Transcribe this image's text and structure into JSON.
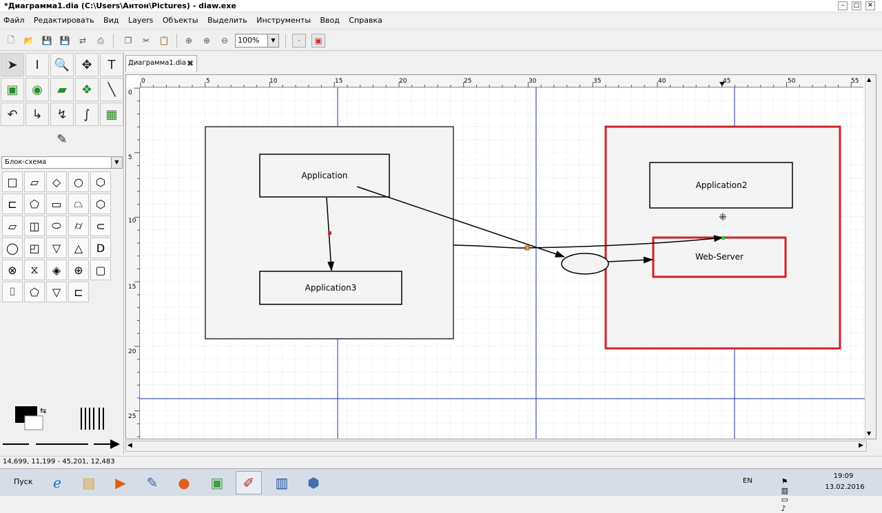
{
  "window": {
    "title": "*Диаграмма1.dia (C:\\Users\\Антон\\Pictures) - diaw.exe",
    "min": "–",
    "max": "□",
    "close": "✕"
  },
  "menu": [
    "Файл",
    "Редактировать",
    "Вид",
    "Layers",
    "Объекты",
    "Выделить",
    "Инструменты",
    "Ввод",
    "Справка"
  ],
  "toolbar": {
    "zoom_value": "100%"
  },
  "toolbox": {
    "sheet": "Блок-схема"
  },
  "tab": {
    "label": "Диаграмма1.dia",
    "close": "✖"
  },
  "diagram": {
    "box_app1": "Application",
    "box_app3": "Application3",
    "box_app2": "Application2",
    "box_web": "Web-Server"
  },
  "ruler": {
    "h_ticks": [
      "0",
      "5",
      "10",
      "15",
      "20",
      "25",
      "30",
      "35",
      "40",
      "45",
      "50",
      "55"
    ],
    "v_ticks": [
      "0",
      "5",
      "10",
      "15",
      "20",
      "25"
    ]
  },
  "status": {
    "coords": "14,699, 11,199 - 45,201, 12,483"
  },
  "taskbar": {
    "start": "Пуск",
    "lang": "EN",
    "time": "19:09",
    "date": "13.02.2016"
  },
  "colors": {
    "selection_red": "#d0202a",
    "guide_blue": "#2030a0",
    "grid": "#d8dce8"
  }
}
